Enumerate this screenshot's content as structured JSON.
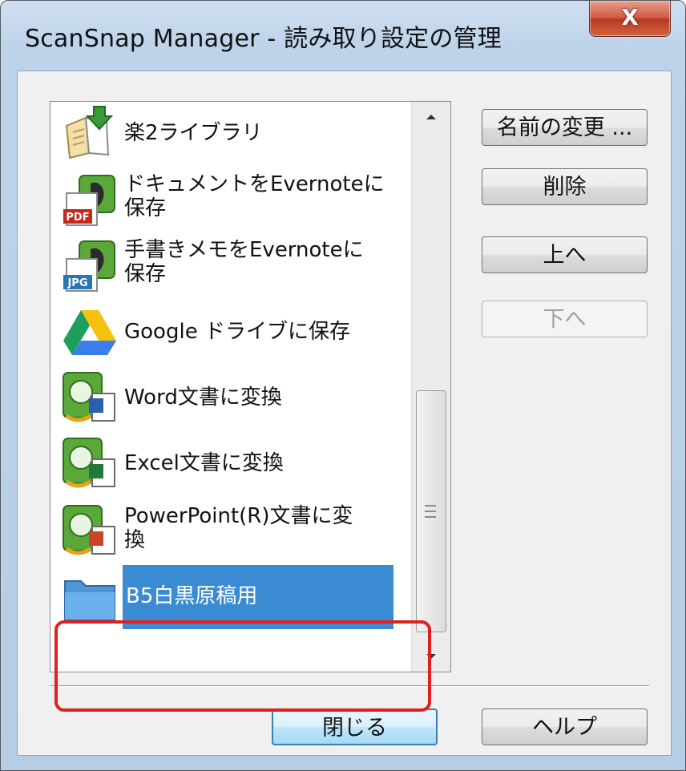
{
  "window": {
    "title": "ScanSnap Manager - 読み取り設定の管理",
    "close_glyph": "X"
  },
  "list": {
    "items": [
      {
        "label": "楽2ライブラリ",
        "icon": "rakuraku-library-icon"
      },
      {
        "label": "ドキュメントをEvernoteに\n保存",
        "icon": "evernote-pdf-icon"
      },
      {
        "label": "手書きメモをEvernoteに\n保存",
        "icon": "evernote-jpg-icon"
      },
      {
        "label": "Google ドライブに保存",
        "icon": "google-drive-icon"
      },
      {
        "label": "Word文書に変換",
        "icon": "word-convert-icon"
      },
      {
        "label": "Excel文書に変換",
        "icon": "excel-convert-icon"
      },
      {
        "label": "PowerPoint(R)文書に変\n換",
        "icon": "powerpoint-convert-icon"
      },
      {
        "label": "B5白黒原稿用",
        "icon": "folder-icon",
        "selected": true
      }
    ]
  },
  "icons": {
    "pdf_badge": "PDF",
    "jpg_badge": "JPG"
  },
  "buttons": {
    "rename": "名前の変更 ...",
    "delete": "削除",
    "up": "上へ",
    "down": "下へ",
    "close": "閉じる",
    "help": "ヘルプ"
  },
  "colors": {
    "selection": "#3a8bd2",
    "highlight_frame": "#e02020"
  }
}
